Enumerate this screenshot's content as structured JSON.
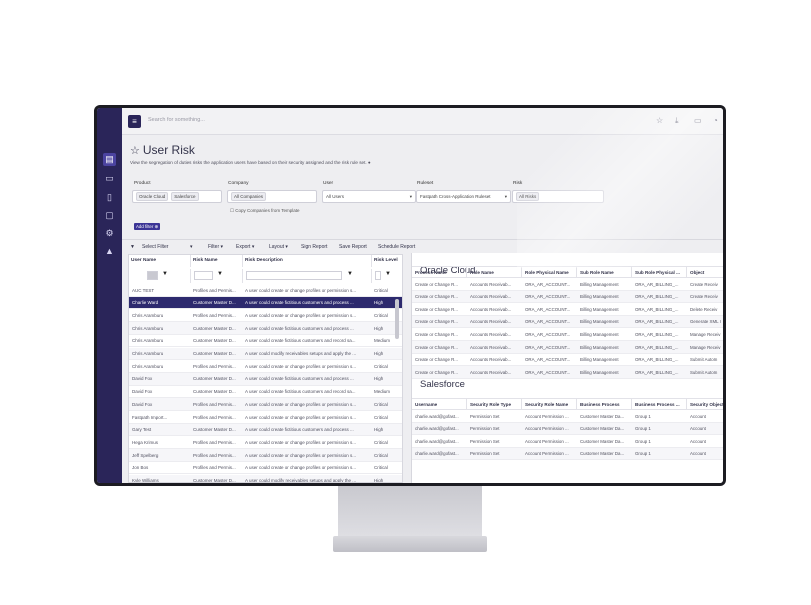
{
  "topbar": {
    "search_placeholder": "Search for something..."
  },
  "page": {
    "title": "User Risk",
    "subtitle": "View the segregation of duties risks the application users have based on their security assigned and the risk rule set."
  },
  "filters": {
    "product_label": "Product",
    "product_chips": [
      "Oracle Cloud",
      "Salesforce"
    ],
    "company_label": "Company",
    "company_value": "All Companies",
    "user_label": "User",
    "user_value": "All Users",
    "ruleset_label": "Ruleset",
    "ruleset_value": "Fastpath Cross-Application Ruleset",
    "risk_label": "Risk",
    "risk_value": "All Risks",
    "copy_companies": "Copy Companies from Template",
    "add_filter": "Add filter"
  },
  "toolbar": {
    "select_filter": "Select Filter",
    "filter": "Filter",
    "export": "Export",
    "layout": "Layout",
    "sign_report": "Sign Report",
    "save_report": "Save Report",
    "schedule_report": "Schedule Report"
  },
  "left_table": {
    "headers": [
      "User Name",
      "Risk Name",
      "Risk Description",
      "Risk Level"
    ],
    "rows": [
      [
        "AUC TEST",
        "Profiles and Permis...",
        "A user could create or change profiles or permission s...",
        "Critical"
      ],
      [
        "Charlie Ward",
        "Customer Master D...",
        "A user could create fictitious customers and process ...",
        "High"
      ],
      [
        "Chris Aramburu",
        "Profiles and Permis...",
        "A user could create or change profiles or permission s...",
        "Critical"
      ],
      [
        "Chris Aramburu",
        "Customer Master D...",
        "A user could create fictitious customers and process ...",
        "High"
      ],
      [
        "Chris Aramburu",
        "Customer Master D...",
        "A user could create fictitious customers and record sa...",
        "Medium"
      ],
      [
        "Chris Aramburu",
        "Customer Master D...",
        "A user could modify receivables setups and apply the ...",
        "High"
      ],
      [
        "Chris Aramburu",
        "Profiles and Permis...",
        "A user could create or change profiles or permission s...",
        "Critical"
      ],
      [
        "David Fox",
        "Customer Master D...",
        "A user could create fictitious customers and process ...",
        "High"
      ],
      [
        "David Fox",
        "Customer Master D...",
        "A user could create fictitious customers and record sa...",
        "Medium"
      ],
      [
        "David Fox",
        "Profiles and Permis...",
        "A user could create or change profiles or permission s...",
        "Critical"
      ],
      [
        "Fastpath Import...",
        "Profiles and Permis...",
        "A user could create or change profiles or permission s...",
        "Critical"
      ],
      [
        "Gary Test",
        "Customer Master D...",
        "A user could create fictitious customers and process ...",
        "High"
      ],
      [
        "Hega Krimus",
        "Profiles and Permis...",
        "A user could create or change profiles or permission s...",
        "Critical"
      ],
      [
        "Jeff Spelberg",
        "Profiles and Permis...",
        "A user could create or change profiles or permission s...",
        "Critical"
      ],
      [
        "Jon Bos",
        "Profiles and Permis...",
        "A user could create or change profiles or permission s...",
        "Critical"
      ],
      [
        "Kyle Williams",
        "Customer Master D...",
        "A user could modify receivables setups and apply the ...",
        "High"
      ]
    ]
  },
  "oracle": {
    "title": "Oracle Cloud",
    "headers": [
      "Process Name",
      "Role Name",
      "Role Physical Name",
      "Sub Role Name",
      "Sub Role Physical ...",
      "Object"
    ],
    "rows": [
      [
        "Create or Change R...",
        "Accounts Receivab...",
        "ORA_AR_ACCOUNT...",
        "Billing Management",
        "ORA_AR_BILLING_...",
        "Create Receiv"
      ],
      [
        "Create or Change R...",
        "Accounts Receivab...",
        "ORA_AR_ACCOUNT...",
        "Billing Management",
        "ORA_AR_BILLING_...",
        "Create Receiv"
      ],
      [
        "Create or Change R...",
        "Accounts Receivab...",
        "ORA_AR_ACCOUNT...",
        "Billing Management",
        "ORA_AR_BILLING_...",
        "Delete Receiv"
      ],
      [
        "Create or Change R...",
        "Accounts Receivab...",
        "ORA_AR_ACCOUNT...",
        "Billing Management",
        "ORA_AR_BILLING_...",
        "Generate XML I"
      ],
      [
        "Create or Change R...",
        "Accounts Receivab...",
        "ORA_AR_ACCOUNT...",
        "Billing Management",
        "ORA_AR_BILLING_...",
        "Manage Receiv"
      ],
      [
        "Create or Change R...",
        "Accounts Receivab...",
        "ORA_AR_ACCOUNT...",
        "Billing Management",
        "ORA_AR_BILLING_...",
        "Manage Receiv"
      ],
      [
        "Create or Change R...",
        "Accounts Receivab...",
        "ORA_AR_ACCOUNT...",
        "Billing Management",
        "ORA_AR_BILLING_...",
        "Submit AutoIn"
      ],
      [
        "Create or Change R...",
        "Accounts Receivab...",
        "ORA_AR_ACCOUNT...",
        "Billing Management",
        "ORA_AR_BILLING_...",
        "Submit AutoIn"
      ]
    ]
  },
  "salesforce": {
    "title": "Salesforce",
    "headers": [
      "Username",
      "Security Role Type",
      "Security Role Name",
      "Business Process",
      "Business Process ...",
      "Security Object"
    ],
    "rows": [
      [
        "charlie.ward@gofast...",
        "Permission Set",
        "Account Permission ...",
        "Customer Master Da...",
        "Group 1",
        "Account"
      ],
      [
        "charlie.ward@gofast...",
        "Permission Set",
        "Account Permission ...",
        "Customer Master Da...",
        "Group 1",
        "Account"
      ],
      [
        "charlie.ward@gofast...",
        "Permission Set",
        "Account Permission ...",
        "Customer Master Da...",
        "Group 1",
        "Account"
      ],
      [
        "charlie.ward@gofast...",
        "Permission Set",
        "Account Permission ...",
        "Customer Master Da...",
        "Group 1",
        "Account"
      ]
    ]
  },
  "icons": [
    "menu-icon",
    "star-icon",
    "download-icon",
    "inbox-icon",
    "filter-icon",
    "info-icon"
  ],
  "colors": {
    "sidebar": "#2a2559",
    "accent": "#3b3496",
    "selected_row": "#2d2a6e"
  }
}
